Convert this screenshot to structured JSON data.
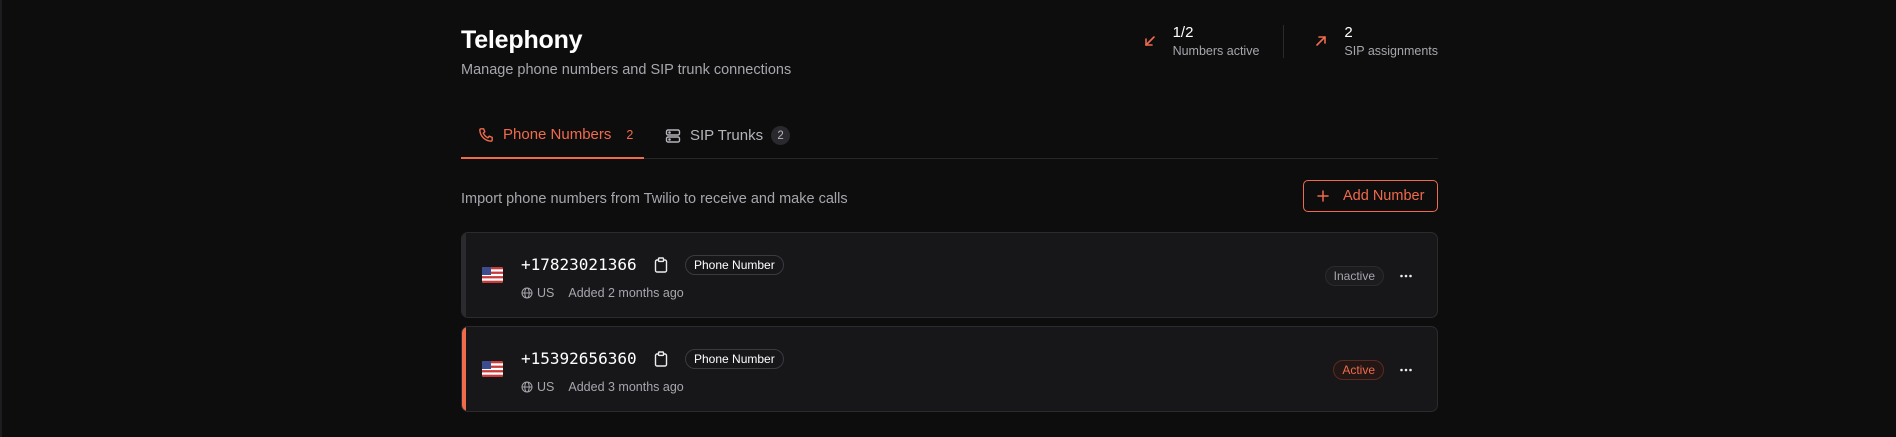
{
  "page": {
    "title": "Telephony",
    "subtitle": "Manage phone numbers and SIP trunk connections"
  },
  "stats": [
    {
      "value": "1/2",
      "label": "Numbers active",
      "icon": "arrow-down-left-icon"
    },
    {
      "value": "2",
      "label": "SIP assignments",
      "icon": "arrow-up-right-icon"
    }
  ],
  "tabs": [
    {
      "label": "Phone Numbers",
      "count": "2",
      "icon": "phone-icon",
      "active": true
    },
    {
      "label": "SIP Trunks",
      "count": "2",
      "icon": "server-icon",
      "active": false
    }
  ],
  "toolbar": {
    "description": "Import phone numbers from Twilio to receive and make calls",
    "add_label": "Add Number"
  },
  "numbers": [
    {
      "number": "+17823021366",
      "type": "Phone Number",
      "country": "US",
      "added": "Added 2 months ago",
      "status": "Inactive",
      "active": false
    },
    {
      "number": "+15392656360",
      "type": "Phone Number",
      "country": "US",
      "added": "Added 3 months ago",
      "status": "Active",
      "active": true
    }
  ],
  "colors": {
    "background": "#0d0d0e",
    "accent": "#f06a4c",
    "card": "#17171a",
    "muted_text": "#a6a6ac"
  }
}
